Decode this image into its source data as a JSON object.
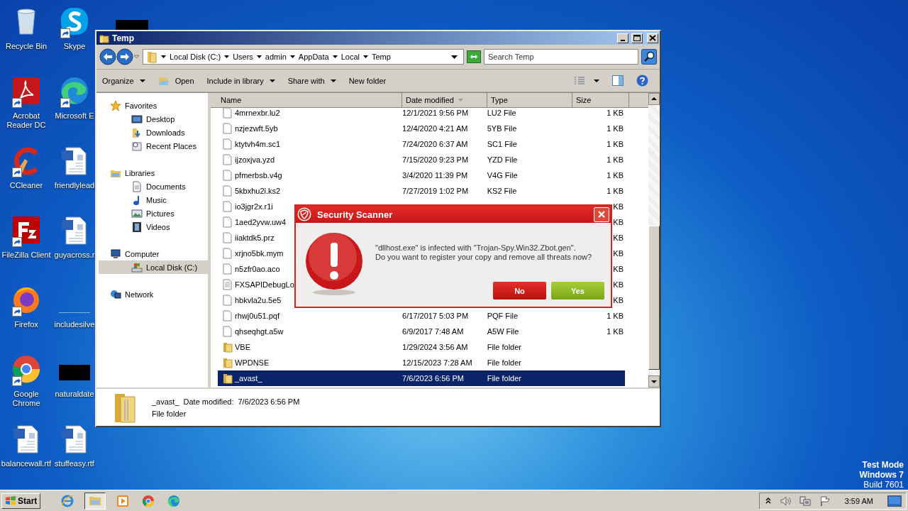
{
  "desktop": {
    "icons": [
      {
        "label": "Recycle Bin",
        "kind": "recycle",
        "shortcut": false
      },
      {
        "label": "Acrobat Reader DC",
        "kind": "acrobat",
        "shortcut": true
      },
      {
        "label": "CCleaner",
        "kind": "ccleaner",
        "shortcut": true
      },
      {
        "label": "FileZilla Client",
        "kind": "filezilla",
        "shortcut": true
      },
      {
        "label": "Firefox",
        "kind": "firefox",
        "shortcut": true
      },
      {
        "label": "Google Chrome",
        "kind": "chrome",
        "shortcut": true
      },
      {
        "label": "balancewall.rtf",
        "kind": "document",
        "shortcut": false
      },
      {
        "label": "Skype",
        "kind": "skype",
        "shortcut": true
      },
      {
        "label": "Microsoft E",
        "kind": "edge",
        "shortcut": true
      },
      {
        "label": "friendlylead",
        "kind": "document",
        "shortcut": false
      },
      {
        "label": "guyacross.r",
        "kind": "document",
        "shortcut": false
      },
      {
        "label": "includesilve",
        "kind": "blank",
        "shortcut": false
      },
      {
        "label": "naturaldate",
        "kind": "redacted",
        "shortcut": false
      },
      {
        "label": "stuffeasy.rtf",
        "kind": "document",
        "shortcut": false
      }
    ]
  },
  "explorer": {
    "title": "Temp",
    "breadcrumbs": [
      "Local Disk (C:)",
      "Users",
      "admin",
      "AppData",
      "Local",
      "Temp"
    ],
    "search": {
      "placeholder": "Search Temp"
    },
    "toolbar": [
      {
        "label": "Organize",
        "kind": "plain",
        "dropdown": true
      },
      {
        "label": "Open",
        "kind": "open",
        "dropdown": false
      },
      {
        "label": "Include in library",
        "kind": "plain",
        "dropdown": true
      },
      {
        "label": "Share with",
        "kind": "plain",
        "dropdown": true
      },
      {
        "label": "New folder",
        "kind": "plain",
        "dropdown": false
      }
    ],
    "nav": [
      {
        "label": "Favorites",
        "kind": "star",
        "selected": false,
        "children": [
          {
            "label": "Desktop",
            "kind": "desktop",
            "selected": false
          },
          {
            "label": "Downloads",
            "kind": "downloads",
            "selected": false
          },
          {
            "label": "Recent Places",
            "kind": "recent",
            "selected": false
          }
        ]
      },
      {
        "label": "Libraries",
        "kind": "library",
        "selected": false,
        "children": [
          {
            "label": "Documents",
            "kind": "documents",
            "selected": false
          },
          {
            "label": "Music",
            "kind": "music",
            "selected": false
          },
          {
            "label": "Pictures",
            "kind": "pictures",
            "selected": false
          },
          {
            "label": "Videos",
            "kind": "videos",
            "selected": false
          }
        ]
      },
      {
        "label": "Computer",
        "kind": "computer",
        "selected": false,
        "children": [
          {
            "label": "Local Disk (C:)",
            "kind": "drive",
            "selected": true
          }
        ]
      },
      {
        "label": "Network",
        "kind": "network",
        "selected": false
      }
    ],
    "columns": [
      {
        "label": "Name",
        "sorted": false
      },
      {
        "label": "Date modified",
        "sorted": true
      },
      {
        "label": "Type",
        "sorted": false
      },
      {
        "label": "Size",
        "sorted": false
      }
    ],
    "rows": [
      {
        "name": "4mrnexbr.lu2",
        "date": "12/1/2021 9:56 PM",
        "type": "LU2 File",
        "size": "1 KB",
        "kind": "file",
        "selected": false
      },
      {
        "name": "nzjezwft.5yb",
        "date": "12/4/2020 4:21 AM",
        "type": "5YB File",
        "size": "1 KB",
        "kind": "file",
        "selected": false
      },
      {
        "name": "ktytvh4m.sc1",
        "date": "7/24/2020 6:37 AM",
        "type": "SC1 File",
        "size": "1 KB",
        "kind": "file",
        "selected": false
      },
      {
        "name": "ijzoxjva.yzd",
        "date": "7/15/2020 9:23 PM",
        "type": "YZD File",
        "size": "1 KB",
        "kind": "file",
        "selected": false
      },
      {
        "name": "pfmerbsb.v4g",
        "date": "3/4/2020 11:39 PM",
        "type": "V4G File",
        "size": "1 KB",
        "kind": "file",
        "selected": false
      },
      {
        "name": "5kbxhu2i.ks2",
        "date": "7/27/2019 1:02 PM",
        "type": "KS2 File",
        "size": "1 KB",
        "kind": "file",
        "selected": false
      },
      {
        "name": "io3jgr2x.r1i",
        "size": "KB",
        "kind": "file",
        "selected": false
      },
      {
        "name": "1aed2yvw.uw4",
        "size": "KB",
        "kind": "file",
        "selected": false
      },
      {
        "name": "iiaktdk5.prz",
        "size": "KB",
        "kind": "file",
        "selected": false
      },
      {
        "name": "xrjno5bk.mym",
        "size": "KB",
        "kind": "file",
        "selected": false
      },
      {
        "name": "n5zfr0ao.aco",
        "size": "KB",
        "kind": "file",
        "selected": false
      },
      {
        "name": "FXSAPIDebugLo",
        "size": "KB",
        "kind": "text",
        "selected": false
      },
      {
        "name": "hbkvla2u.5e5",
        "size": "KB",
        "kind": "file",
        "selected": false
      },
      {
        "name": "rhwj0u51.pqf",
        "date": "6/17/2017 5:03 PM",
        "type": "PQF File",
        "size": "1 KB",
        "kind": "file",
        "selected": false
      },
      {
        "name": "qhseqhgt.a5w",
        "date": "6/9/2017 7:48 AM",
        "type": "A5W File",
        "size": "1 KB",
        "kind": "file",
        "selected": false
      },
      {
        "name": "VBE",
        "date": "1/29/2024 3:56 AM",
        "type": "File folder",
        "kind": "folder",
        "selected": false
      },
      {
        "name": "WPDNSE",
        "date": "12/15/2023 7:28 AM",
        "type": "File folder",
        "kind": "folder",
        "selected": false
      },
      {
        "name": "_avast_",
        "date": "7/6/2023 6:56 PM",
        "type": "File folder",
        "kind": "folder",
        "selected": true
      }
    ],
    "details": {
      "name": "_avast_",
      "date_label": "Date modified:",
      "date": "7/6/2023 6:56 PM",
      "type": "File folder"
    }
  },
  "dialog": {
    "title": "Security Scanner",
    "message": [
      "\"dllhost.exe\" is infected with \"Trojan-Spy.Win32.Zbot.gen\".",
      "Do you want to register your copy and remove all threats now?"
    ],
    "buttons": [
      {
        "label": "No",
        "kind": "no"
      },
      {
        "label": "Yes",
        "kind": "yes"
      }
    ]
  },
  "system_info": [
    "Test Mode",
    "Windows 7",
    "Build 7601"
  ],
  "taskbar": {
    "start": "Start",
    "apps": [
      {
        "kind": "ie",
        "active": false
      },
      {
        "kind": "explorer",
        "active": true
      },
      {
        "kind": "media",
        "active": false
      },
      {
        "kind": "chrome",
        "active": false
      },
      {
        "kind": "edge",
        "active": false
      }
    ],
    "clock": "3:59 AM"
  }
}
